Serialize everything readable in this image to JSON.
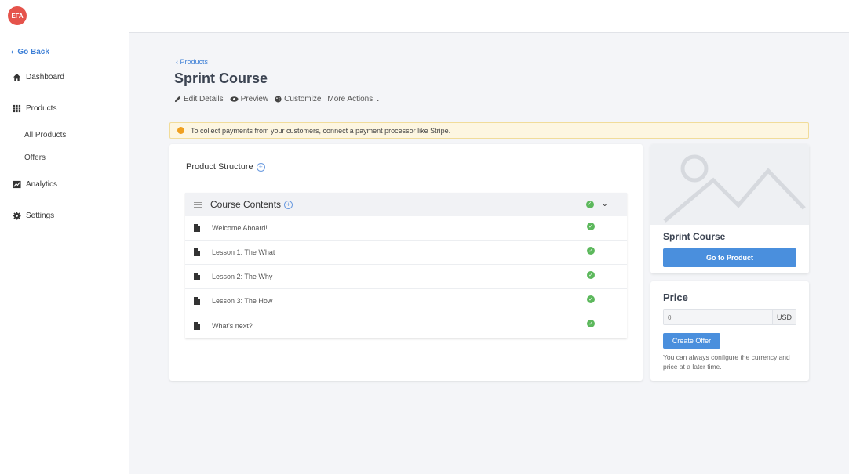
{
  "logo": {
    "text": "EFA"
  },
  "sidebar": {
    "go_back": "Go Back",
    "items": [
      {
        "label": "Dashboard"
      },
      {
        "label": "Products"
      },
      {
        "label": "All Products"
      },
      {
        "label": "Offers"
      },
      {
        "label": "Analytics"
      },
      {
        "label": "Settings"
      }
    ]
  },
  "header": {
    "breadcrumb": "Products",
    "title": "Sprint Course",
    "actions": {
      "edit": "Edit Details",
      "preview": "Preview",
      "customize": "Customize",
      "more": "More Actions"
    }
  },
  "alert": {
    "text": "To collect payments from your customers, connect a payment processor like Stripe."
  },
  "structure": {
    "label": "Product Structure",
    "section_title": "Course Contents",
    "lessons": [
      {
        "label": "Welcome Aboard!"
      },
      {
        "label": "Lesson 1: The What"
      },
      {
        "label": "Lesson 2: The Why"
      },
      {
        "label": "Lesson 3: The How"
      },
      {
        "label": "What's next?"
      }
    ]
  },
  "product_card": {
    "name": "Sprint Course",
    "button": "Go to Product"
  },
  "price": {
    "title": "Price",
    "placeholder": "0",
    "currency": "USD",
    "button": "Create Offer",
    "note": "You can always configure the currency and price at a later time."
  },
  "colors": {
    "accent": "#4a8fdd",
    "link": "#3d7fd6",
    "success": "#5cb85c",
    "warning": "#f0a020",
    "logo": "#e5534b"
  }
}
